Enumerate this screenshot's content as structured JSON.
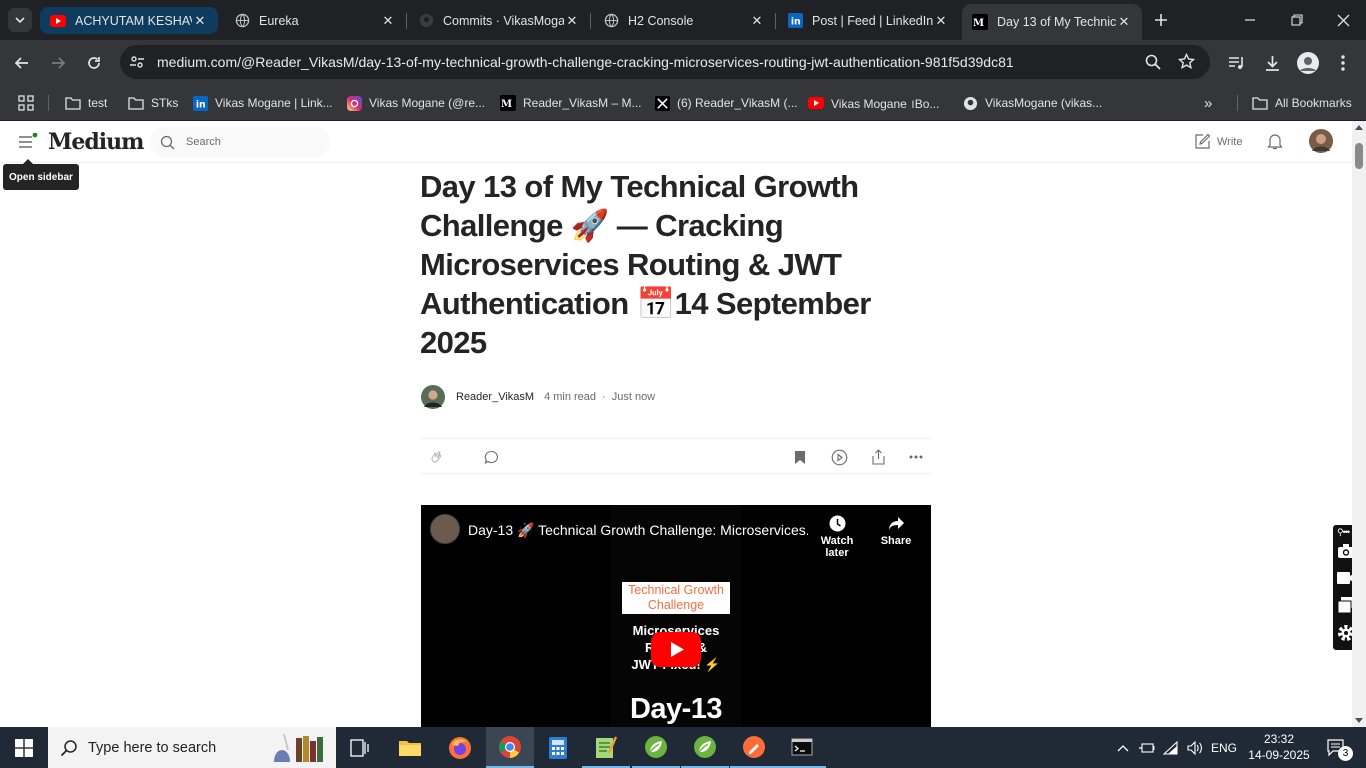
{
  "tabs": [
    {
      "title": "ACHYUTAM KESHAVA",
      "icon": "youtube-icon",
      "group": true
    },
    {
      "title": "Eureka",
      "icon": "globe-icon"
    },
    {
      "title": "Commits · VikasMoga",
      "icon": "github-icon"
    },
    {
      "title": "H2 Console",
      "icon": "globe-icon"
    },
    {
      "title": "Post | Feed | LinkedIn",
      "icon": "linkedin-icon"
    },
    {
      "title": "Day 13 of My Technic",
      "icon": "medium-icon",
      "active": true
    }
  ],
  "toolbar": {
    "url": "medium.com/@Reader_VikasM/day-13-of-my-technical-growth-challenge-cracking-microservices-routing-jwt-authentication-981f5d39dc81"
  },
  "bookmarks": {
    "items": [
      {
        "label": "test",
        "icon": "folder-icon"
      },
      {
        "label": "STks",
        "icon": "folder-icon"
      },
      {
        "label": "Vikas Mogane | Link...",
        "icon": "linkedin-icon"
      },
      {
        "label": "Vikas Mogane (@re...",
        "icon": "instagram-icon"
      },
      {
        "label": "Reader_VikasM – M...",
        "icon": "medium-icon"
      },
      {
        "label": "(6) Reader_VikasM (...",
        "icon": "x-icon"
      },
      {
        "label": "Vikas Mogane ।Bo...",
        "icon": "youtube-icon"
      },
      {
        "label": "VikasMogane (vikas...",
        "icon": "github-icon"
      }
    ],
    "all_label": "All Bookmarks"
  },
  "medium": {
    "logo": "Medium",
    "search_placeholder": "Search",
    "write_label": "Write",
    "tooltip": "Open sidebar"
  },
  "article": {
    "title": "Day 13 of My Technical Growth Challenge 🚀 — Cracking Microservices Routing & JWT Authentication 📅14 September 2025",
    "author": "Reader_VikasM",
    "read_time": "4 min read",
    "published": "Just now",
    "video": {
      "title": "Day-13 🚀 Technical Growth Challenge: Microservices...",
      "watch_later": "Watch later",
      "share": "Share",
      "thumb_heading": "Technical Growth Challenge",
      "thumb_line1": "Microservices",
      "thumb_line2": "Routing &",
      "thumb_line3": "JWT Fixed! ⚡",
      "thumb_day": "Day-13"
    }
  },
  "taskbar": {
    "search_placeholder": "Type here to search",
    "lang": "ENG",
    "time": "23:32",
    "date": "14-09-2025",
    "notifications": "3"
  },
  "colors": {
    "chrome_dark": "#202124",
    "chrome_toolbar": "#35363a",
    "tab_group": "#0f3b5e",
    "medium_text": "#242424",
    "youtube_red": "#ff0000",
    "taskbar": "#1f2a36"
  }
}
